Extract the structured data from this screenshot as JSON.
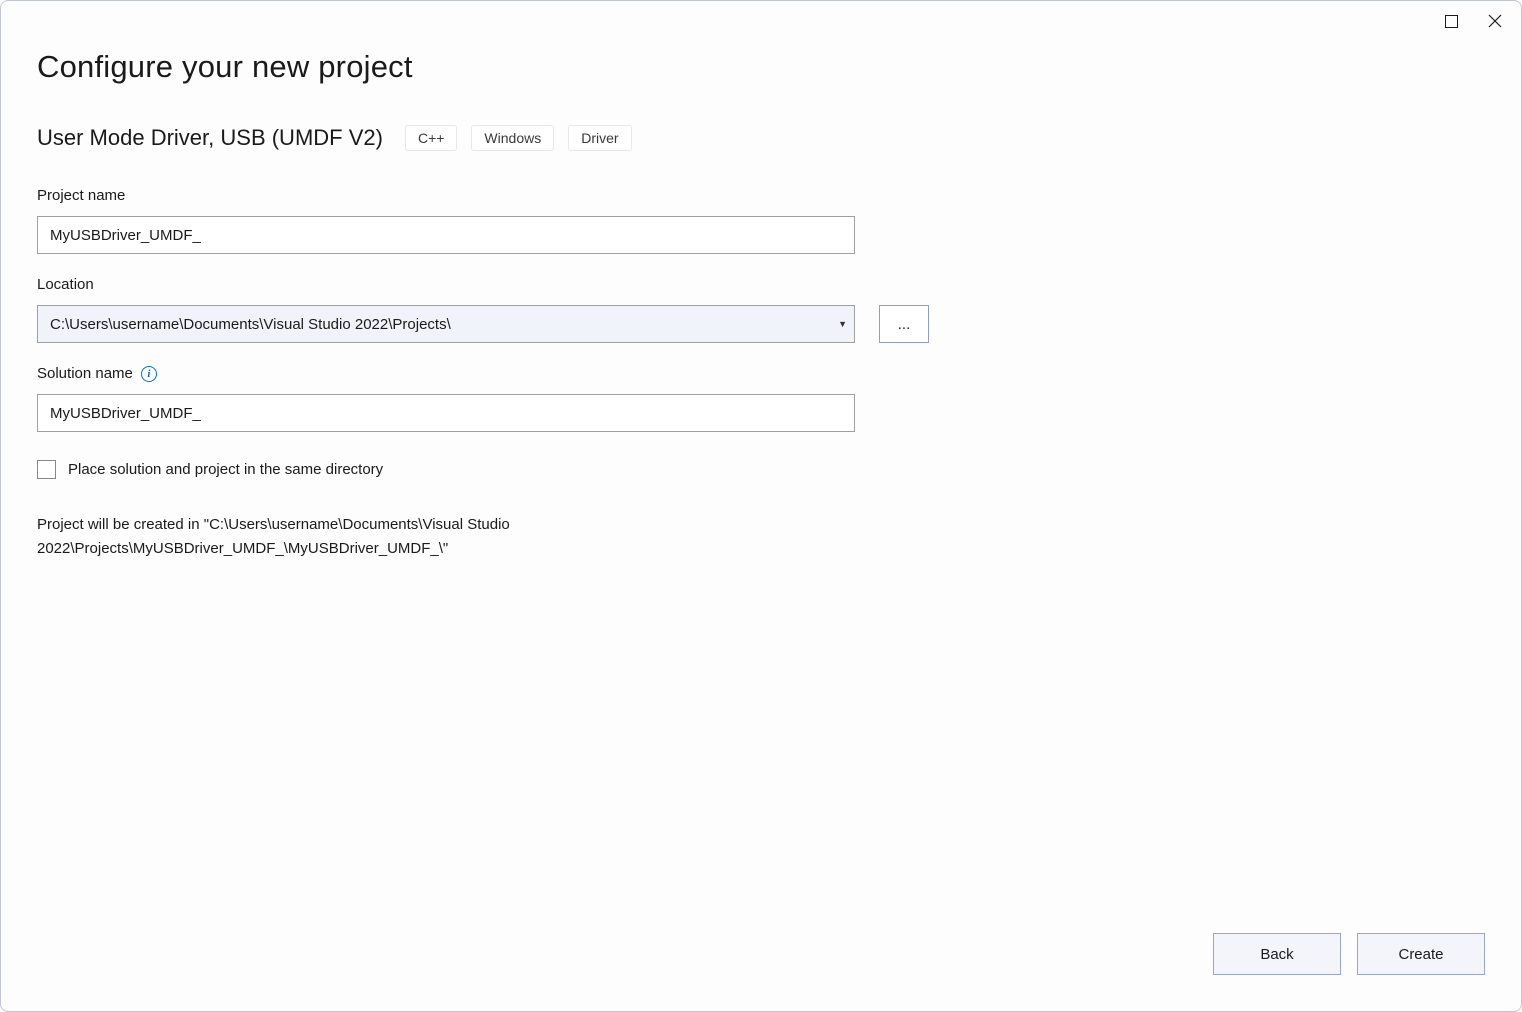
{
  "header": {
    "page_title": "Configure your new project",
    "template_name": "User Mode Driver, USB (UMDF V2)",
    "tags": [
      "C++",
      "Windows",
      "Driver"
    ]
  },
  "fields": {
    "project_name": {
      "label": "Project name",
      "value": "MyUSBDriver_UMDF_"
    },
    "location": {
      "label": "Location",
      "value": "C:\\Users\\username\\Documents\\Visual Studio 2022\\Projects\\",
      "browse_label": "..."
    },
    "solution_name": {
      "label": "Solution name",
      "value": "MyUSBDriver_UMDF_"
    },
    "same_dir_checkbox": {
      "label": "Place solution and project in the same directory",
      "checked": false
    }
  },
  "hint": "Project will be created in \"C:\\Users\\username\\Documents\\Visual Studio 2022\\Projects\\MyUSBDriver_UMDF_\\MyUSBDriver_UMDF_\\\"",
  "footer": {
    "back_label": "Back",
    "create_label": "Create"
  }
}
